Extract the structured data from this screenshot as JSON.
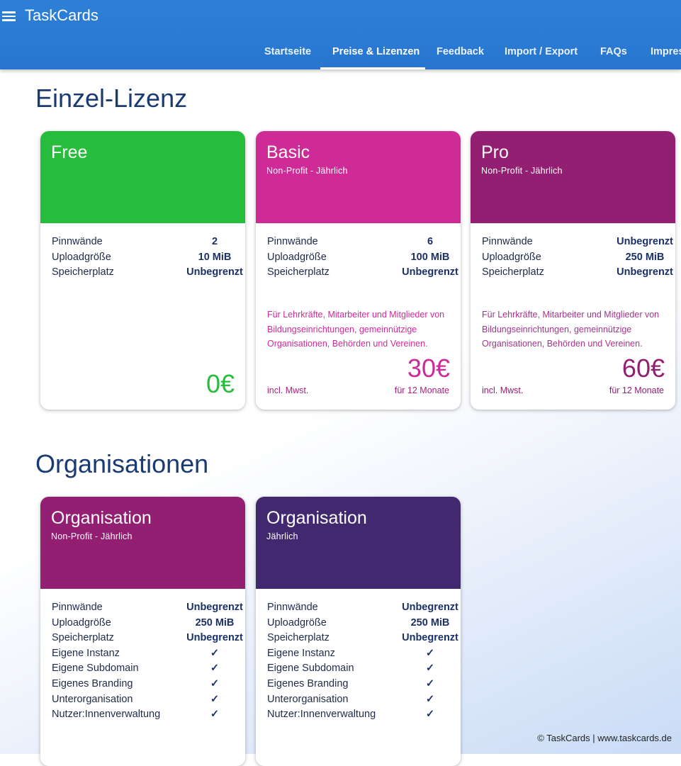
{
  "app": {
    "title": "TaskCards"
  },
  "nav": [
    {
      "label": "Startseite"
    },
    {
      "label": "Preise & Lizenzen"
    },
    {
      "label": "Feedback"
    },
    {
      "label": "Import / Export"
    },
    {
      "label": "FAQs"
    },
    {
      "label": "Impres"
    }
  ],
  "sections": {
    "single": "Einzel-Lizenz",
    "org": "Organisationen"
  },
  "colors": {
    "free": "#26bd3c",
    "basic": "#cf2b97",
    "pro": "#921f72",
    "org_np": "#921f72",
    "org": "#42296f",
    "heading": "#1a3a73"
  },
  "cards": {
    "free": {
      "title": "Free",
      "features": [
        {
          "label": "Pinnwände",
          "value": "2"
        },
        {
          "label": "Uploadgröße",
          "value": "10 MiB"
        },
        {
          "label": "Speicherplatz",
          "value": "Unbegrenzt"
        }
      ],
      "price": "0€"
    },
    "basic": {
      "title": "Basic",
      "subtitle": "Non-Profit - Jährlich",
      "features": [
        {
          "label": "Pinnwände",
          "value": "6"
        },
        {
          "label": "Uploadgröße",
          "value": "100 MiB"
        },
        {
          "label": "Speicherplatz",
          "value": "Unbegrenzt"
        }
      ],
      "description": "Für Lehrkräfte, Mitarbeiter und Mitglieder von Bildungseinrichtungen, gemeinnützige Organisationen, Behörden und Vereinen.",
      "price": "30€",
      "tax_note": "incl. Mwst.",
      "period": "für 12 Monate"
    },
    "pro": {
      "title": "Pro",
      "subtitle": "Non-Profit - Jährlich",
      "features": [
        {
          "label": "Pinnwände",
          "value": "Unbegrenzt"
        },
        {
          "label": "Uploadgröße",
          "value": "250 MiB"
        },
        {
          "label": "Speicherplatz",
          "value": "Unbegrenzt"
        }
      ],
      "description": "Für Lehrkräfte, Mitarbeiter und Mitglieder von Bildungseinrichtungen, gemeinnützige Organisationen, Behörden und Vereinen.",
      "price": "60€",
      "tax_note": "incl. Mwst.",
      "period": "für 12 Monate"
    },
    "org_np": {
      "title": "Organisation",
      "subtitle": "Non-Profit - Jährlich",
      "features": [
        {
          "label": "Pinnwände",
          "value": "Unbegrenzt"
        },
        {
          "label": "Uploadgröße",
          "value": "250 MiB"
        },
        {
          "label": "Speicherplatz",
          "value": "Unbegrenzt"
        },
        {
          "label": "Eigene Instanz",
          "value": "✓"
        },
        {
          "label": "Eigene Subdomain",
          "value": "✓"
        },
        {
          "label": "Eigenes Branding",
          "value": "✓"
        },
        {
          "label": "Unterorganisation",
          "value": "✓"
        },
        {
          "label": "Nutzer:Innenverwaltung",
          "value": "✓"
        }
      ]
    },
    "org": {
      "title": "Organisation",
      "subtitle": "Jährlich",
      "features": [
        {
          "label": "Pinnwände",
          "value": "Unbegrenzt"
        },
        {
          "label": "Uploadgröße",
          "value": "250 MiB"
        },
        {
          "label": "Speicherplatz",
          "value": "Unbegrenzt"
        },
        {
          "label": "Eigene Instanz",
          "value": "✓"
        },
        {
          "label": "Eigene Subdomain",
          "value": "✓"
        },
        {
          "label": "Eigenes Branding",
          "value": "✓"
        },
        {
          "label": "Unterorganisation",
          "value": "✓"
        },
        {
          "label": "Nutzer:Innenverwaltung",
          "value": "✓"
        }
      ]
    }
  },
  "footer": {
    "copyright": "© TaskCards | www.taskcards.de"
  }
}
